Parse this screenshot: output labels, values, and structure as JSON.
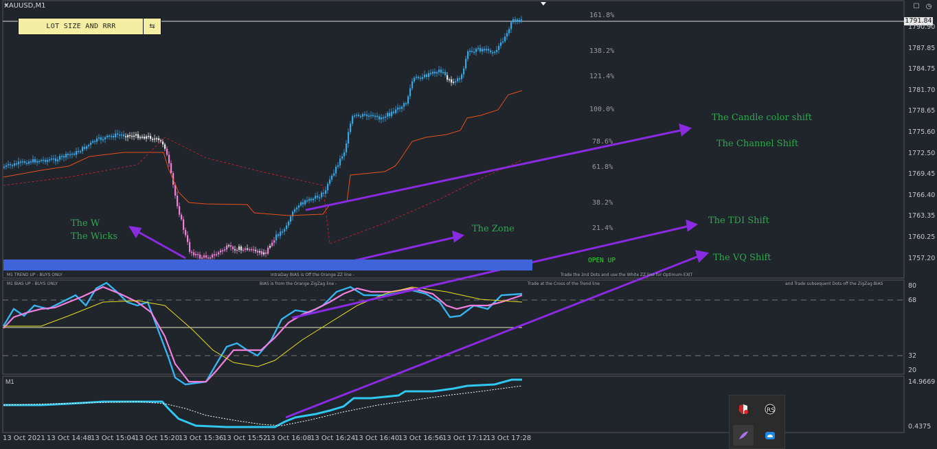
{
  "symbol": "XAUUSD,M1",
  "lot_button": {
    "label": "LOT SIZE AND RRR"
  },
  "price_tag": "1791.84",
  "price_axis": [
    "1790.90",
    "1787.85",
    "1784.75",
    "1781.70",
    "1778.65",
    "1775.60",
    "1772.50",
    "1769.45",
    "1766.40",
    "1763.35",
    "1760.25",
    "1757.20"
  ],
  "fib_levels": [
    "161.8%",
    "138.2%",
    "121.4%",
    "100.0%",
    "78.6%",
    "61.8%",
    "38.2%",
    "21.4%"
  ],
  "annotations": {
    "candle_color_shift": "The Candle color shift",
    "channel_shift": "The Channel Shift",
    "tdi_shift": "The TDI Shift",
    "vq_shift": "The VQ Shift",
    "the_zone": "The Zone",
    "the_w": "The W\nThe Wicks"
  },
  "open_up": "OPEN UP",
  "bar_labels": {
    "trend": "M1 TREND UP - BUYS ONLY",
    "intraday": "IntraDay BIAS is Off the Orange ZZ line -",
    "trade2": "Trade the 2nd Dots and use the White ZZ line for Optimum EXIT"
  },
  "tdi_labels": {
    "bias": "M1 BIAS UP - BUYS ONLY",
    "from": "BIAS is from the Orange ZigZag line -",
    "cross": "Trade at the Cross of the Trend line",
    "subsequent": "and Trade subsequent Dots off the ZigZag BIAS"
  },
  "tdi_axis": [
    "80",
    "68",
    "32",
    "20"
  ],
  "vq": {
    "title": "M1",
    "top": "14.9669",
    "bottom": "0.4375"
  },
  "time_axis": [
    "13 Oct 2021",
    "13 Oct 14:48",
    "13 Oct 15:04",
    "13 Oct 15:20",
    "13 Oct 15:36",
    "13 Oct 15:52",
    "13 Oct 16:08",
    "13 Oct 16:24",
    "13 Oct 16:40",
    "13 Oct 16:56",
    "13 Oct 17:12",
    "13 Oct 17:28"
  ]
}
